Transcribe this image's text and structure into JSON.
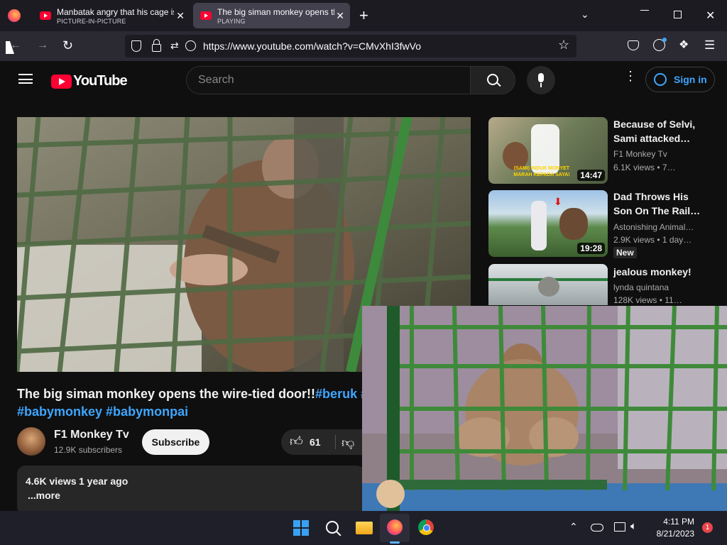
{
  "browser": {
    "tabs": [
      {
        "title": "Manbatak angry that his cage is",
        "subtitle": "PICTURE-IN-PICTURE"
      },
      {
        "title": "The big siman monkey opens the",
        "subtitle": "PLAYING"
      }
    ],
    "url": "https://www.youtube.com/watch?v=CMvXhI3fwVo"
  },
  "youtube": {
    "logo_text": "YouTube",
    "search_placeholder": "Search",
    "sign_in": "Sign in",
    "video": {
      "title_main": "The big siman monkey opens the wire-tied door!!",
      "title_tag_inline": "#beruk #",
      "tags_line2": "#babymonkey #babymonpai",
      "channel": "F1 Monkey Tv",
      "subscribers": "12.9K subscribers",
      "subscribe": "Subscribe",
      "likes": "61",
      "views": "4.6K views",
      "age": "1 year ago",
      "more": "...more"
    },
    "recommendations": [
      {
        "title_l1": "Because of Selvi,",
        "title_l2": "Sami attacked…",
        "channel": "F1 Monkey Tv",
        "meta": "6.1K views  • 7…",
        "duration": "14:47",
        "caption": "(SAMI) INDUK MONYET MARAH KEPADA SAYA!",
        "badge": ""
      },
      {
        "title_l1": "Dad Throws His",
        "title_l2": "Son On The Rail…",
        "channel": "Astonishing Animal…",
        "meta": "2.9K views  • 1 day…",
        "duration": "19:28",
        "caption": "",
        "badge": "New"
      },
      {
        "title_l1": "jealous monkey!",
        "title_l2": "",
        "channel": "lynda quintana",
        "meta": "128K views  • 11…",
        "duration": "",
        "caption": "",
        "badge": ""
      }
    ]
  },
  "taskbar": {
    "time": "4:11 PM",
    "date": "8/21/2023",
    "notifications": "1"
  },
  "colors": {
    "yt_red": "#ff0033",
    "link_blue": "#3ea6ff",
    "taskbar": "#1f1f2a"
  }
}
